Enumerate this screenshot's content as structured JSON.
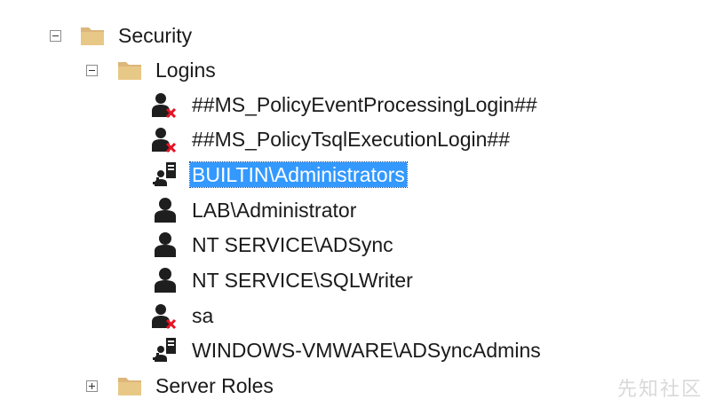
{
  "tree": {
    "security": {
      "label": "Security",
      "expanded": true
    },
    "logins": {
      "label": "Logins",
      "expanded": true
    },
    "items": [
      {
        "label": "##MS_PolicyEventProcessingLogin##",
        "icon": "disabled-login-icon",
        "selected": false
      },
      {
        "label": "##MS_PolicyTsqlExecutionLogin##",
        "icon": "disabled-login-icon",
        "selected": false
      },
      {
        "label": "BUILTIN\\Administrators",
        "icon": "group-login-icon",
        "selected": true
      },
      {
        "label": "LAB\\Administrator",
        "icon": "user-login-icon",
        "selected": false
      },
      {
        "label": "NT SERVICE\\ADSync",
        "icon": "user-login-icon",
        "selected": false
      },
      {
        "label": "NT SERVICE\\SQLWriter",
        "icon": "user-login-icon",
        "selected": false
      },
      {
        "label": "sa",
        "icon": "disabled-login-icon",
        "selected": false
      },
      {
        "label": "WINDOWS-VMWARE\\ADSyncAdmins",
        "icon": "group-login-icon",
        "selected": false
      }
    ],
    "server_roles": {
      "label": "Server Roles",
      "expanded": false
    }
  },
  "watermark": "先知社区",
  "colors": {
    "selection": "#3399ff",
    "folder": "#dcb67a",
    "disabled_x": "#e81123"
  }
}
